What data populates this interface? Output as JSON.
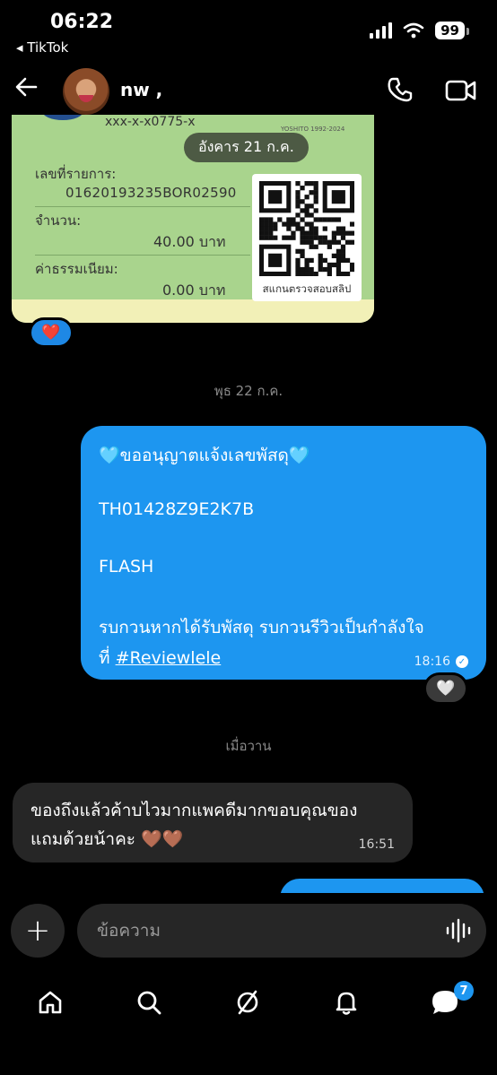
{
  "status": {
    "time": "06:22",
    "back_app": "◂ TikTok",
    "battery": "99"
  },
  "header": {
    "contact_name": "nw ,"
  },
  "slip": {
    "account": "xxx-x-x0775-x",
    "date": "อังคาร 21 ก.ค.",
    "small_print": "YOSHITO 1992-2024",
    "ref_label": "เลขที่รายการ:",
    "ref_value": "01620193235BOR02590",
    "amount_label": "จำนวน:",
    "amount_value": "40.00 บาท",
    "fee_label": "ค่าธรรมเนียม:",
    "fee_value": "0.00 บาท",
    "qr_caption": "สแกนตรวจสอบสลิป"
  },
  "reactions": {
    "slip": "❤️",
    "outgoing": "🤍"
  },
  "separators": {
    "first": "พุธ 22 ก.ค.",
    "second": "เมื่อวาน"
  },
  "outgoing_message": {
    "line1": "🩵ขออนุญาตแจ้งเลขพัสดุ🩵",
    "line2": "TH01428Z9E2K7B",
    "line3": "FLASH",
    "line4": "รบกวนหากได้รับพัสดุ รบกวนรีวิวเป็นกำลังใจ",
    "line5_prefix": "ที่ ",
    "line5_link": "#Reviewlele",
    "time": "18:16"
  },
  "incoming_message": {
    "line1": "ของถึงแล้วค้าบไวมากแพคดีมากขอบคุณของ",
    "line2": "แถมด้วยน้าคะ 🤎🤎",
    "time": "16:51"
  },
  "composer": {
    "placeholder": "ข้อความ",
    "add_label": "+"
  },
  "nav": {
    "inbox_badge": "7"
  },
  "colors": {
    "accent": "#1d96f0",
    "incoming_bubble": "#262626",
    "background": "#000000"
  }
}
